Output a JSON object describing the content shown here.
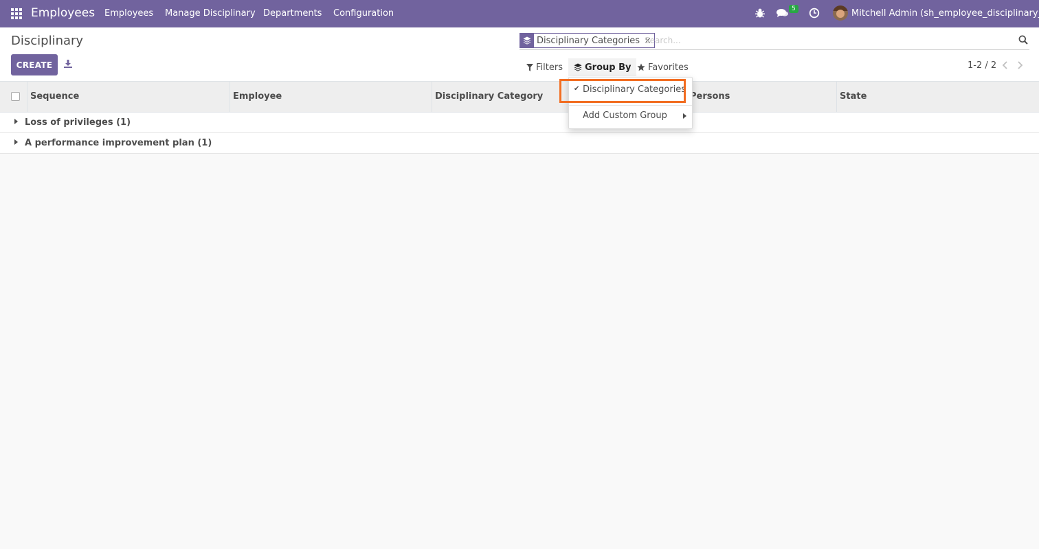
{
  "navbar": {
    "app_name": "Employees",
    "menu": [
      "Employees",
      "Manage Disciplinary",
      "Departments",
      "Configuration"
    ],
    "messages_badge": "5",
    "user": "Mitchell Admin (sh_employee_disciplinary__)",
    "icons": [
      "apps-grid-icon",
      "bug-icon",
      "chat-icon",
      "clock-icon"
    ]
  },
  "control_panel": {
    "breadcrumb": "Disciplinary",
    "create_label": "CREATE",
    "search": {
      "facet_label": "Disciplinary Categories",
      "facet_remove": "×",
      "placeholder": "Search..."
    },
    "filters_label": "Filters",
    "group_by_label": "Group By",
    "favorites_label": "Favorites",
    "pager": "1-2 / 2"
  },
  "table": {
    "columns": [
      "Sequence",
      "Employee",
      "Disciplinary Category",
      "Persons",
      "State"
    ],
    "groups": [
      {
        "label": "Loss of privileges (1)"
      },
      {
        "label": "A performance improvement plan (1)"
      }
    ]
  },
  "group_by_dropdown": {
    "items": [
      {
        "label": "Disciplinary Categories",
        "checked": true
      },
      {
        "label": "Add Custom Group",
        "checked": false
      }
    ]
  },
  "colors": {
    "brand": "#71639e",
    "highlight": "#f26d21",
    "badge": "#28a745"
  }
}
